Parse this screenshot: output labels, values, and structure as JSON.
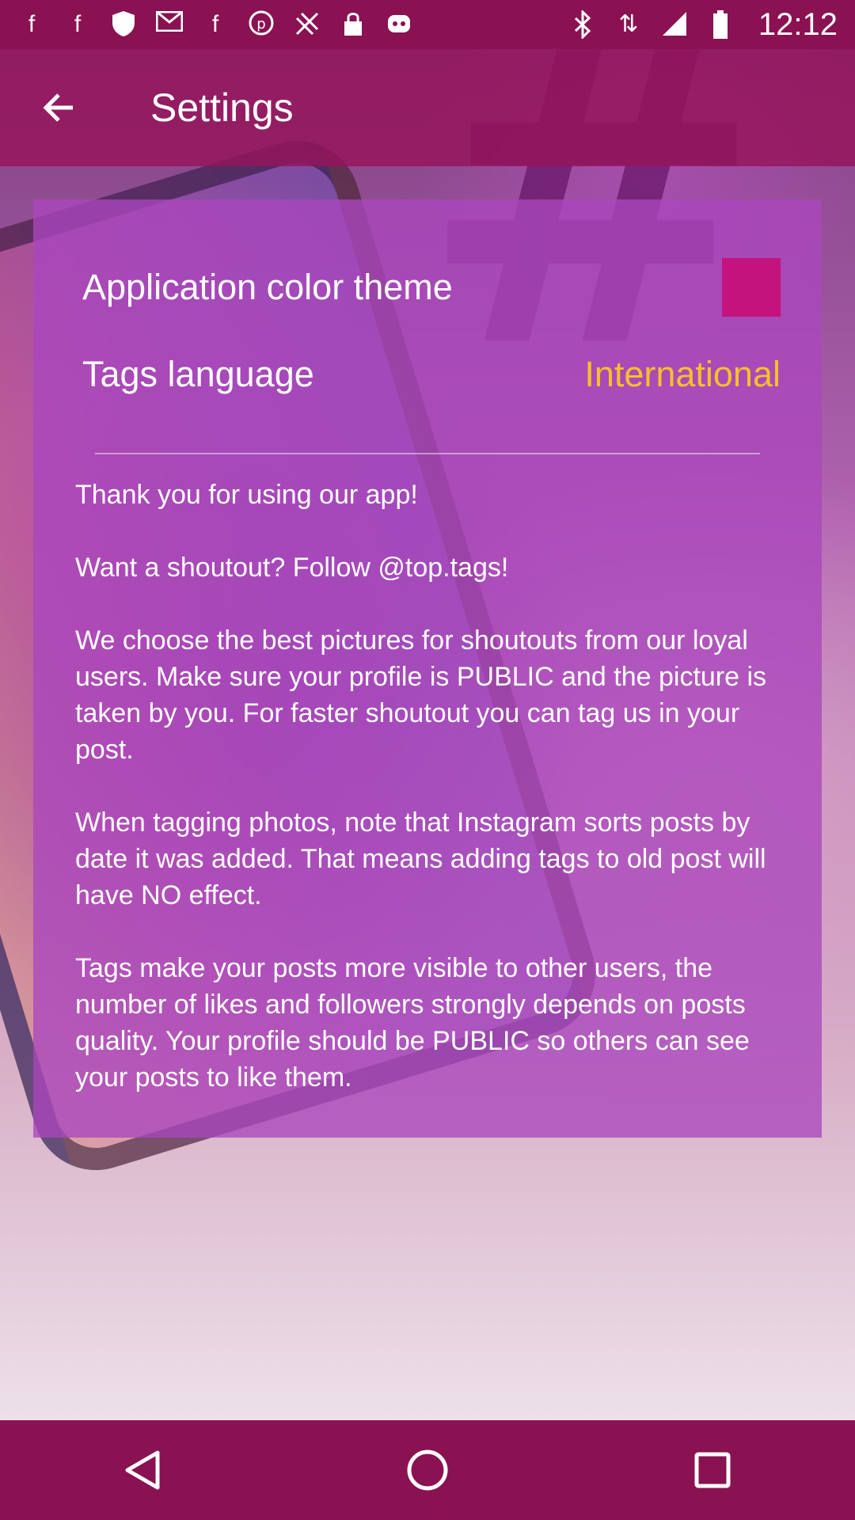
{
  "status_bar": {
    "time": "12:12",
    "left_icons": [
      "facebook-icon",
      "facebook-icon",
      "shield-icon",
      "mail-icon",
      "facebook-icon",
      "pinterest-icon",
      "fake-gps-icon",
      "lock-icon",
      "bot-icon"
    ],
    "right_icons": [
      "bluetooth-icon",
      "data-arrows-icon",
      "signal-icon",
      "battery-icon"
    ]
  },
  "app_bar": {
    "title": "Settings",
    "back_icon": "arrow-back-icon"
  },
  "settings": {
    "theme_label": "Application color theme",
    "theme_color": "#c4137c",
    "language_label": "Tags language",
    "language_value": "International"
  },
  "info": {
    "p1": "Thank you for using our app!",
    "p2": "Want a shoutout? Follow @top.tags!",
    "p3": "We choose the best pictures for shoutouts from our loyal users. Make sure your profile is PUBLIC and the picture is taken by you. For faster shoutout you can tag us in your post.",
    "p4": "When tagging photos, note that Instagram sorts posts by date it was added. That means adding tags to old post will have NO effect.",
    "p5": "Tags make your posts more visible to other users, the number of likes and followers strongly depends on posts quality. Your profile should be PUBLIC so others can see your posts to like them."
  },
  "colors": {
    "primary_dark": "#8a1152",
    "card": "#aa46be",
    "accent_value": "#f5c02a"
  },
  "nav_bar": {
    "buttons": [
      "back-triangle-icon",
      "home-circle-icon",
      "recents-square-icon"
    ]
  }
}
